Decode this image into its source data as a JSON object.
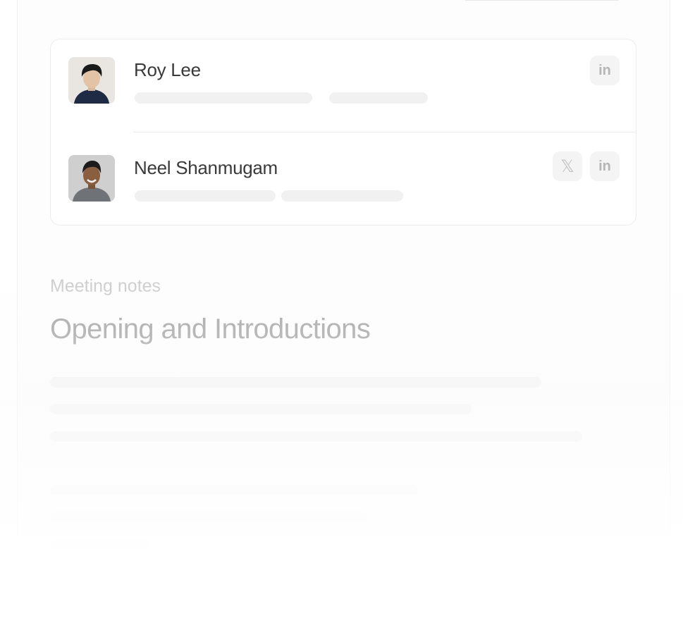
{
  "people": [
    {
      "name": "Roy Lee",
      "avatar": "person-photo",
      "socials": [
        "linkedin-icon"
      ],
      "linkedin_label": "in"
    },
    {
      "name": "Neel Shanmugam",
      "avatar": "person-photo",
      "socials": [
        "x-icon",
        "linkedin-icon"
      ],
      "x_label": "𝕏",
      "linkedin_label": "in"
    }
  ],
  "notes": {
    "label": "Meeting notes",
    "title": "Opening and Introductions"
  },
  "colors": {
    "background": "#ffffff",
    "card_border": "#ececec",
    "skeleton": "#f1f1f1",
    "name_text": "#3a3a3a",
    "muted_text": "#c9c9c9",
    "title_text": "#9c9c9c"
  }
}
